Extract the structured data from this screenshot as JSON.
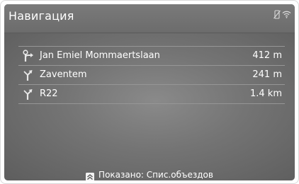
{
  "header": {
    "title": "Навигация",
    "status_icons": [
      "phone-disconnected-icon",
      "wifi-icon"
    ]
  },
  "route_list": [
    {
      "icon": "depart-turn-icon",
      "name": "Jan Emiel Mommaertslaan",
      "distance": "412 m"
    },
    {
      "icon": "fork-turn-icon",
      "name": "Zaventem",
      "distance": "241 m"
    },
    {
      "icon": "fork-turn-icon",
      "name": "R22",
      "distance": "1.4 km"
    }
  ],
  "footer": {
    "button_icon": "double-chevron-up-icon",
    "text": "Показано: Спис.объездов"
  },
  "colors": {
    "screen_bg": "#747474",
    "header_bg": "#6c6c6c",
    "text": "#ffffff",
    "separator": "#969696"
  }
}
